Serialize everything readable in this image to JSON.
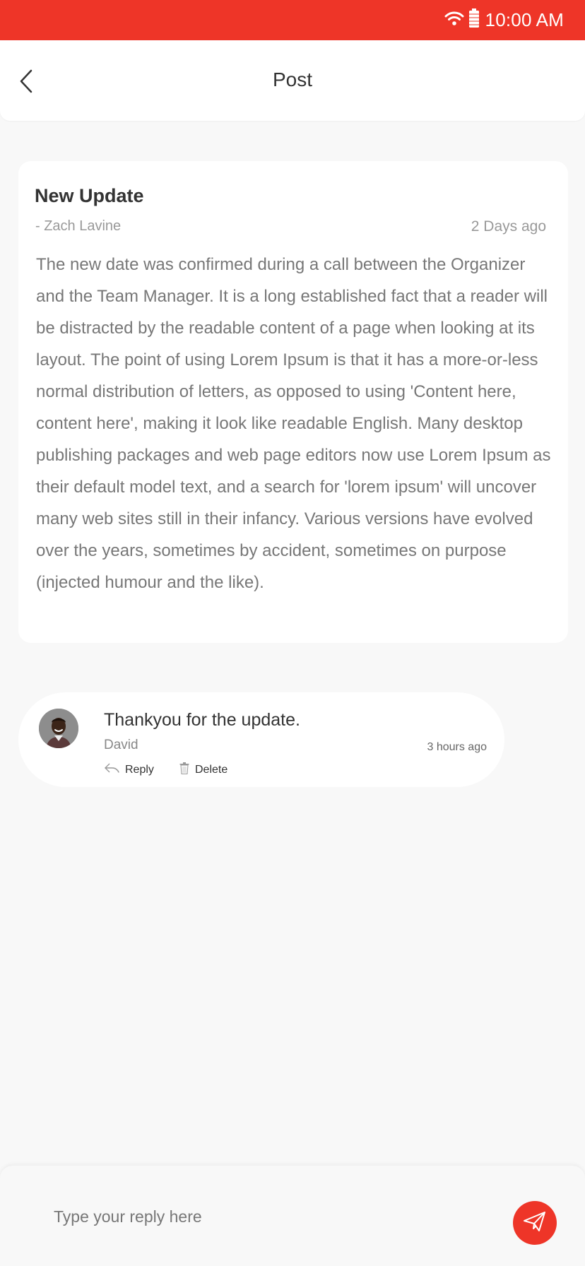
{
  "status_bar": {
    "time": "10:00 AM",
    "icons": [
      "wifi-icon",
      "battery-icon"
    ],
    "background_color": "#ee3528"
  },
  "header": {
    "title": "Post",
    "back_icon": "chevron-left-icon"
  },
  "post": {
    "title": "New Update",
    "author": "- Zach Lavine",
    "time": "2 Days ago",
    "body": "The new date was confirmed during a call between the Organizer  and the Team Manager. It is a long established fact that a reader will be distracted by the readable content of a page when looking at its layout. The point of using Lorem Ipsum is that it has a more-or-less normal distribution of letters, as opposed to using 'Content here, content here', making it look like readable English. Many desktop publishing packages and web page editors now use Lorem Ipsum as their default model text, and a search for 'lorem ipsum' will uncover many web sites still in their infancy. Various versions have evolved over the years, sometimes by accident, sometimes on purpose (injected humour and the like)."
  },
  "comments": [
    {
      "text": "Thankyou for the update.",
      "author": "David",
      "time": "3 hours ago",
      "reply_label": "Reply",
      "delete_label": "Delete"
    }
  ],
  "reply_bar": {
    "placeholder": "Type your reply here",
    "value": "",
    "send_icon": "paper-plane-icon",
    "accent_color": "#ee3528"
  }
}
